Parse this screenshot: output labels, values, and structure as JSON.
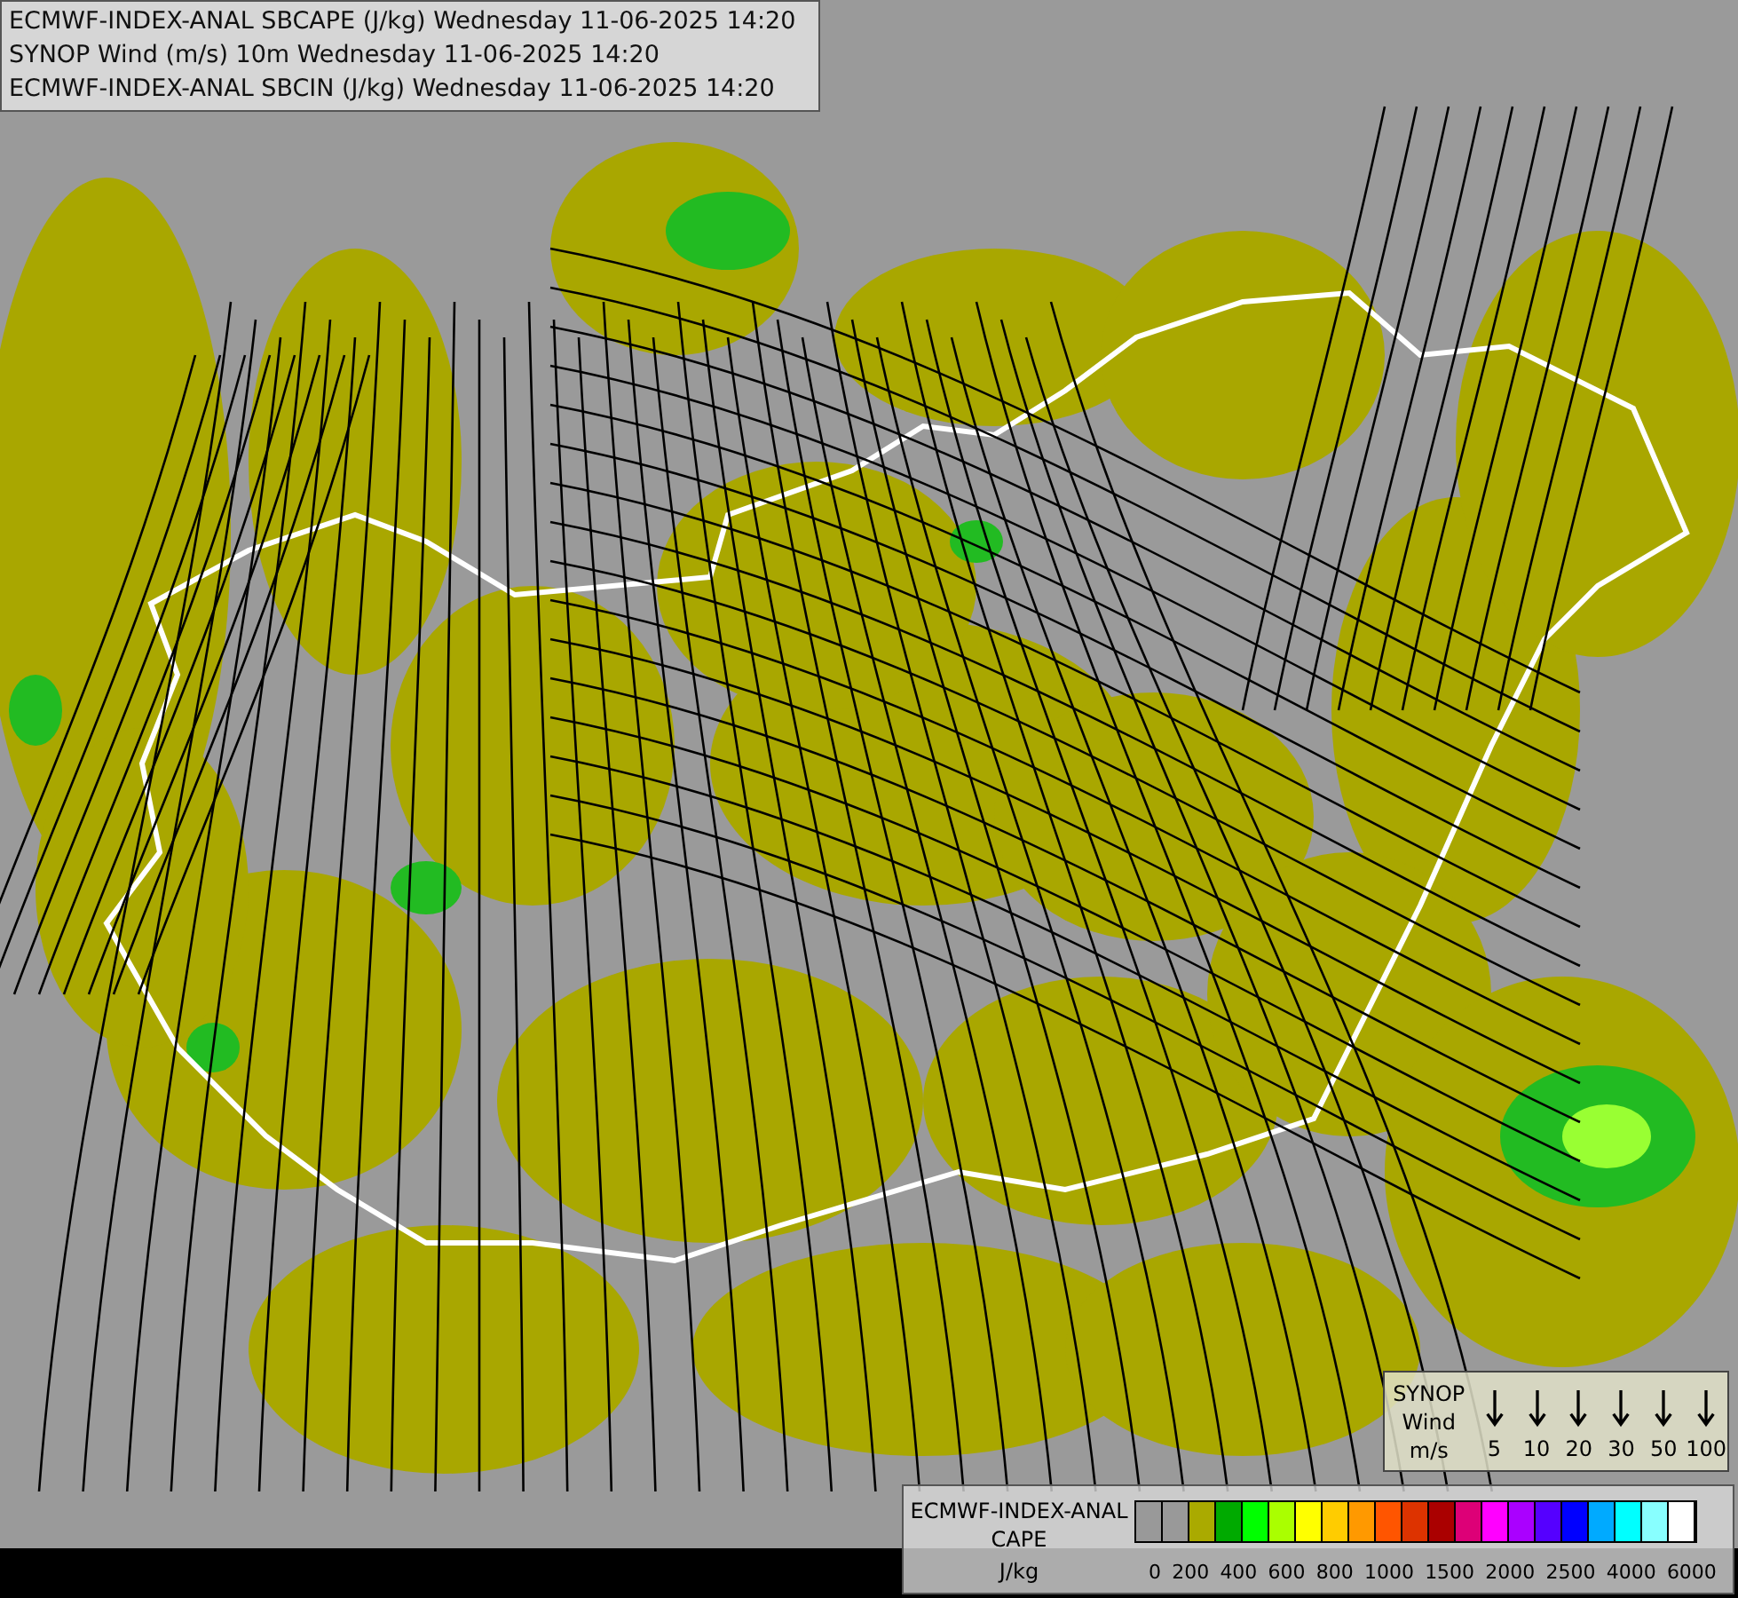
{
  "header": {
    "lines": [
      "ECMWF-INDEX-ANAL SBCAPE (J/kg) Wednesday 11-06-2025 14:20",
      "SYNOP Wind (m/s) 10m Wednesday 11-06-2025 14:20",
      "ECMWF-INDEX-ANAL SBCIN (J/kg) Wednesday 11-06-2025 14:20"
    ]
  },
  "wind_legend": {
    "title": "SYNOP Wind",
    "unit": "m/s",
    "speeds": [
      "5",
      "10",
      "20",
      "30",
      "50",
      "100"
    ]
  },
  "cape_legend": {
    "title": "ECMWF-INDEX-ANAL CAPE",
    "unit": "J/kg",
    "swatches": [
      {
        "color": "#999999"
      },
      {
        "color": "#999999"
      },
      {
        "color": "#aaaa00"
      },
      {
        "color": "#00aa00"
      },
      {
        "color": "#00ff00"
      },
      {
        "color": "#aaff00"
      },
      {
        "color": "#ffff00"
      },
      {
        "color": "#ffcc00"
      },
      {
        "color": "#ff9900"
      },
      {
        "color": "#ff5500"
      },
      {
        "color": "#dd3300"
      },
      {
        "color": "#aa0000"
      },
      {
        "color": "#dd0077"
      },
      {
        "color": "#ff00ff"
      },
      {
        "color": "#aa00ff"
      },
      {
        "color": "#5500ff"
      },
      {
        "color": "#0000ff"
      },
      {
        "color": "#00aaff"
      },
      {
        "color": "#00ffff"
      },
      {
        "color": "#88ffff"
      },
      {
        "color": "#ffffff"
      }
    ],
    "labels": [
      "0",
      "200",
      "400",
      "600",
      "800",
      "1000",
      "1500",
      "2000",
      "2500",
      "4000",
      "6000"
    ]
  }
}
